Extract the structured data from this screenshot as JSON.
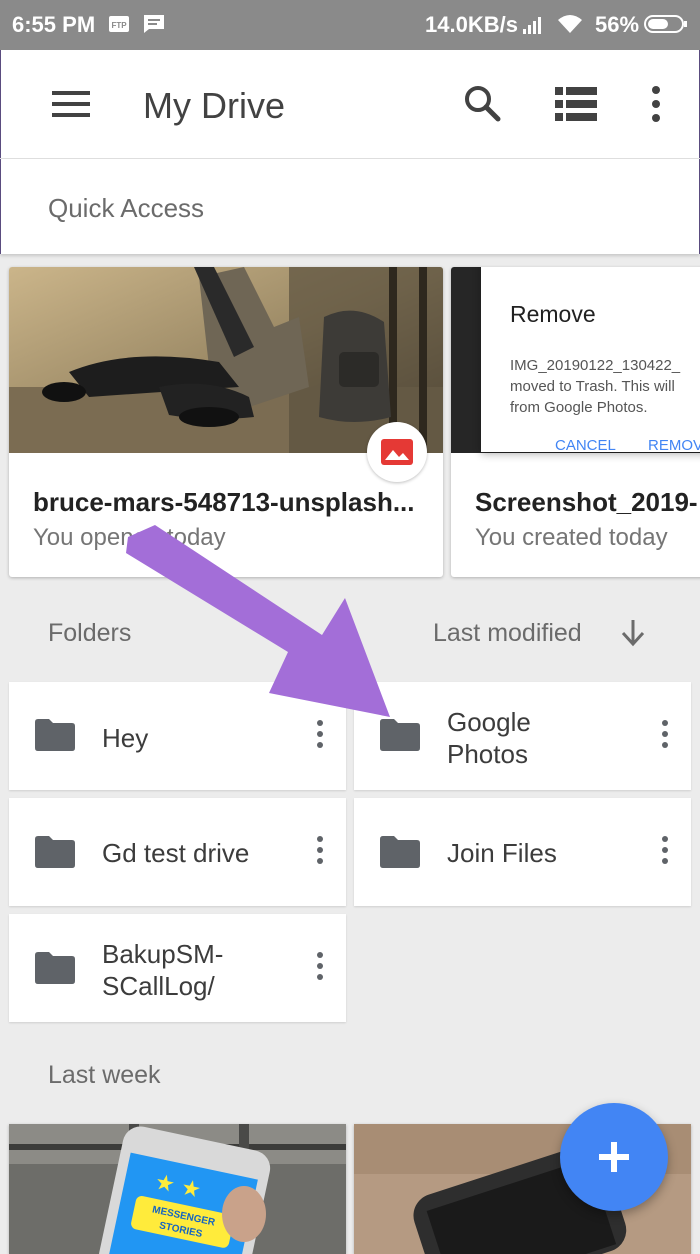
{
  "status_bar": {
    "time": "6:55 PM",
    "speed": "14.0KB/s",
    "battery": "56%"
  },
  "appbar": {
    "title": "My Drive",
    "icons": [
      "menu-icon",
      "search-icon",
      "list-view-icon",
      "more-vert-icon"
    ]
  },
  "quick_access": {
    "label": "Quick Access",
    "cards": [
      {
        "name": "bruce-mars-548713-unsplash...",
        "sub": "You opened today",
        "badge": "image-icon"
      },
      {
        "name": "Screenshot_2019-",
        "sub": "You created today",
        "dialog": {
          "title": "Remove",
          "body_lines": [
            "IMG_20190122_130422_",
            "moved to Trash. This will",
            "from Google Photos."
          ],
          "cancel": "CANCEL",
          "remove": "REMOV"
        }
      }
    ]
  },
  "folders_section": {
    "label": "Folders",
    "sort_label": "Last modified",
    "folders": [
      {
        "name": "Hey"
      },
      {
        "name": "Google\nPhotos"
      },
      {
        "name": "Gd test drive"
      },
      {
        "name": "Join Files"
      },
      {
        "name": "BakupSM-\nSCallLog/"
      }
    ]
  },
  "last_week": {
    "label": "Last week",
    "phone_text": "MESSENGER\nSTORIES"
  },
  "colors": {
    "status_bar": "#8a8a8a",
    "fab": "#4285f4",
    "arrow": "#a36ed8",
    "folder_icon": "#5f6368"
  }
}
